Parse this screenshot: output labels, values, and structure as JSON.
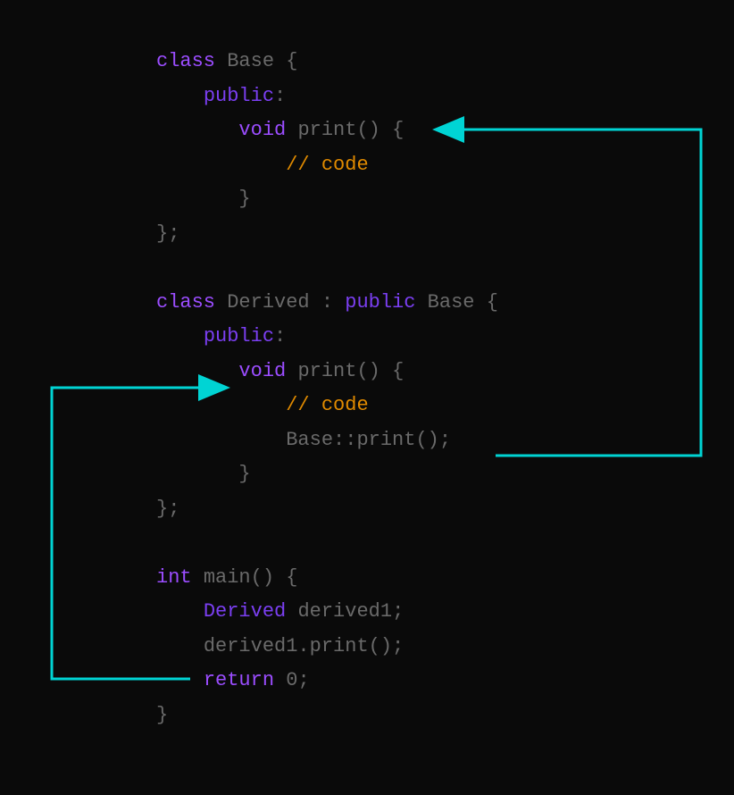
{
  "code": {
    "line1": {
      "kw": "class",
      "name": "Base",
      "brace": "{"
    },
    "line2": {
      "kw": "public",
      "colon": ":"
    },
    "line3": {
      "kw": "void",
      "name": "print",
      "parens": "()",
      "brace": "{"
    },
    "line4": {
      "comment": "// code"
    },
    "line5": {
      "brace": "}"
    },
    "line6": {
      "end": "};"
    },
    "line7": {
      "kw": "class",
      "name": "Derived",
      "colon": ":",
      "access": "public",
      "base": "Base",
      "brace": "{"
    },
    "line8": {
      "kw": "public",
      "colon": ":"
    },
    "line9": {
      "kw": "void",
      "name": "print",
      "parens": "()",
      "brace": "{"
    },
    "line10": {
      "comment": "// code"
    },
    "line11": {
      "call": "Base::print();"
    },
    "line12": {
      "brace": "}"
    },
    "line13": {
      "end": "};"
    },
    "line14": {
      "kw": "int",
      "name": "main",
      "parens": "()",
      "brace": "{"
    },
    "line15": {
      "type": "Derived",
      "var": "derived1",
      "semi": ";"
    },
    "line16": {
      "call": "derived1.print();"
    },
    "line17": {
      "kw": "return",
      "val": "0",
      "semi": ";"
    },
    "line18": {
      "brace": "}"
    }
  },
  "colors": {
    "arrow": "#00d4d4",
    "keyword": "#9b4dff",
    "access": "#7b3ff2",
    "comment": "#e08a00",
    "text": "#6a6a6a"
  }
}
